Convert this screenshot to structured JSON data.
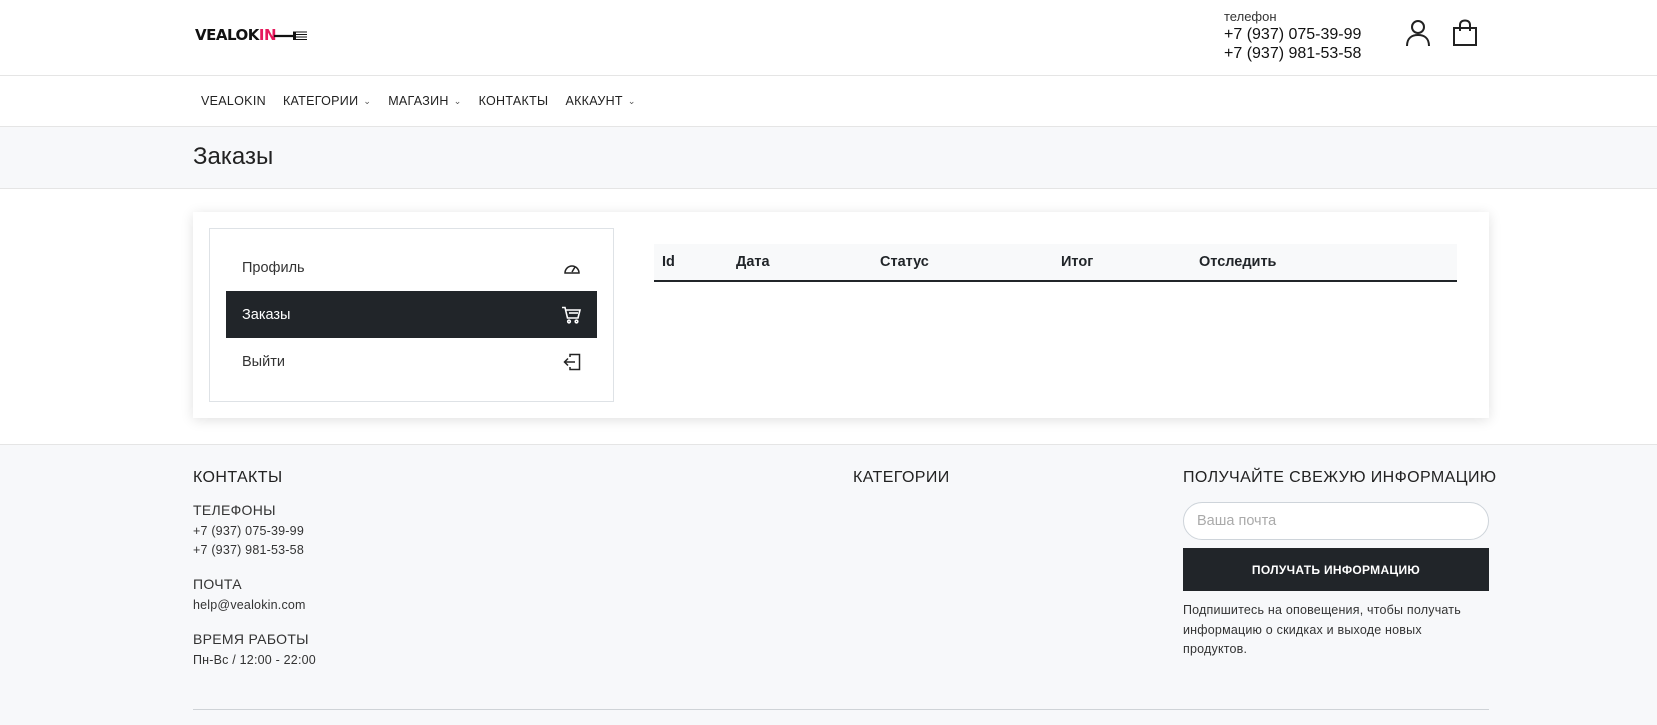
{
  "header": {
    "logo_main": "VEALOK",
    "logo_accent": "IN",
    "phone_label": "телефон",
    "phones": [
      "+7 (937) 075-39-99",
      "+7 (937) 981-53-58"
    ]
  },
  "nav": {
    "items": [
      {
        "label": "VEALOKIN",
        "has_dropdown": false
      },
      {
        "label": "КАТЕГОРИИ",
        "has_dropdown": true
      },
      {
        "label": "МАГАЗИН",
        "has_dropdown": true
      },
      {
        "label": "КОНТАКТЫ",
        "has_dropdown": false
      },
      {
        "label": "АККАУНТ",
        "has_dropdown": true
      }
    ]
  },
  "page": {
    "title": "Заказы"
  },
  "account_menu": {
    "items": [
      {
        "label": "Профиль",
        "icon": "speedometer-icon",
        "active": false
      },
      {
        "label": "Заказы",
        "icon": "cart-icon",
        "active": true
      },
      {
        "label": "Выйти",
        "icon": "logout-icon",
        "active": false
      }
    ]
  },
  "orders_table": {
    "columns": [
      "Id",
      "Дата",
      "Статус",
      "Итог",
      "Отследить"
    ],
    "rows": []
  },
  "footer": {
    "contacts": {
      "heading": "КОНТАКТЫ",
      "phones_label": "ТЕЛЕФОНЫ",
      "phones": [
        "+7 (937) 075-39-99",
        "+7 (937) 981-53-58"
      ],
      "mail_label": "ПОЧТА",
      "email": "help@vealokin.com",
      "hours_label": "ВРЕМЯ РАБОТЫ",
      "hours": "Пн-Вс / 12:00 - 22:00"
    },
    "categories": {
      "heading": "КАТЕГОРИИ"
    },
    "newsletter": {
      "heading": "ПОЛУЧАЙТЕ СВЕЖУЮ ИНФОРМАЦИЮ",
      "placeholder": "Ваша почта",
      "button": "ПОЛУЧАТЬ ИНФОРМАЦИЮ",
      "note": "Подпишитесь на оповещения, чтобы получать информацию о скидках и выходе новых продуктов."
    }
  },
  "colors": {
    "accent_pink": "#e6195c",
    "dark": "#212529",
    "band_bg": "#f7f8fa"
  }
}
